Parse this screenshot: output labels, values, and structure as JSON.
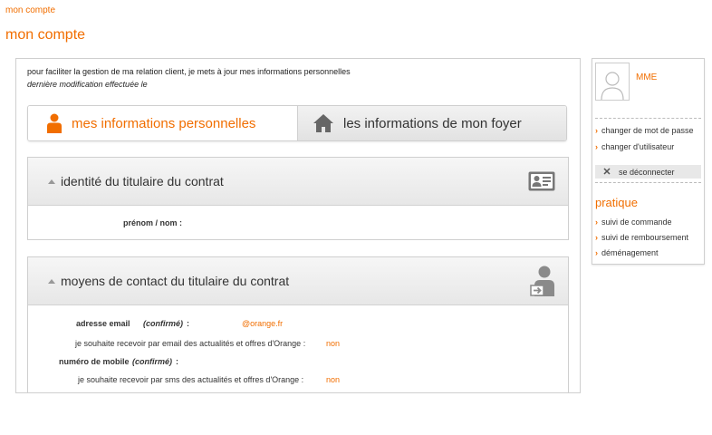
{
  "breadcrumb": "mon compte",
  "page_title": "mon compte",
  "intro": {
    "text": "pour faciliter la gestion de ma relation client, je mets à jour mes informations personnelles",
    "last_modified": "dernière modification effectuée le"
  },
  "tabs": [
    {
      "label": "mes informations personnelles",
      "active": true,
      "icon": "person-icon"
    },
    {
      "label": "les informations de mon foyer",
      "active": false,
      "icon": "house-icon"
    }
  ],
  "identity": {
    "title": "identité du titulaire du contrat",
    "icon": "id-card-icon",
    "name_label": "prénom / nom :",
    "name_value": ""
  },
  "contact": {
    "title": "moyens de contact du titulaire du contrat",
    "icon": "contact-person-icon",
    "email_label": "adresse email",
    "email_confirmed": "(confirmé)",
    "email_colon": ":",
    "email_value": "@orange.fr",
    "email_optin_label": "je souhaite recevoir par email des actualités et offres d'Orange :",
    "email_optin_value": "non",
    "mobile_label": "numéro de mobile",
    "mobile_confirmed": "(confirmé)",
    "mobile_colon": ":",
    "sms_optin_label": "je souhaite recevoir par sms des actualités et offres d'Orange :",
    "sms_optin_value": "non"
  },
  "sidebar": {
    "user_name": "MME",
    "links": [
      "changer de mot de passe",
      "changer d'utilisateur"
    ],
    "logout": "se déconnecter",
    "pratique_title": "pratique",
    "pratique_links": [
      "suivi de commande",
      "suivi de remboursement",
      "déménagement"
    ]
  },
  "colors": {
    "accent": "#f16e00",
    "border": "#cfcfcf"
  }
}
